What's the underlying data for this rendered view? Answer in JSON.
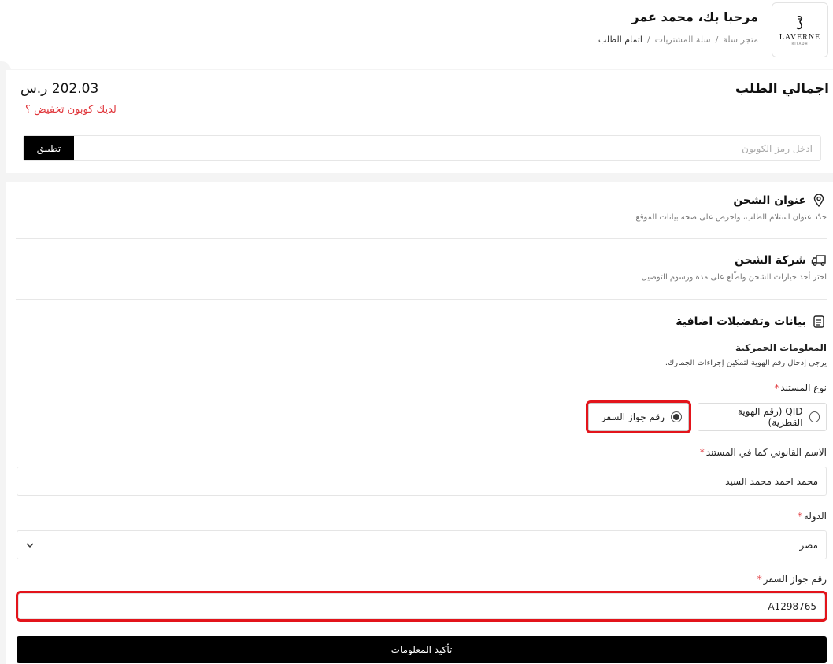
{
  "header": {
    "logo_text": "LAVERNE",
    "logo_sub": "RIYADH",
    "greeting": "مرحبا بك، محمد عمر",
    "breadcrumb": [
      "متجر سلة",
      "سلة المشتريات",
      "اتمام الطلب"
    ],
    "breadcrumb_sep": "/"
  },
  "summary": {
    "title": "اجمالي الطلب",
    "total": "202.03 ر.س",
    "coupon_link": "لديك كوبون تخفيض ؟",
    "coupon_placeholder": "ادخل رمز الكوبون",
    "apply_label": "تطبيق"
  },
  "shipping_address": {
    "title": "عنوان الشحن",
    "subtitle": "حدّد عنوان استلام الطلب، واحرص على صحة بيانات الموقع"
  },
  "shipping_company": {
    "title": "شركة الشحن",
    "subtitle": "اختر أحد خيارات الشحن واطّلع على مدة ورسوم التوصيل"
  },
  "extra": {
    "title": "بيانات وتفضيلات اضافية",
    "customs_title": "المعلومات الجمركية",
    "customs_sub": "يرجى إدخال رقم الهوية لتمكين إجراءات الجمارك.",
    "doc_type_label": "نوع المستند",
    "doc_options": [
      {
        "label": "رقم جواز السفر",
        "checked": true
      },
      {
        "label": "QID (رقم الهوية القطرية)",
        "checked": false
      }
    ],
    "legal_name_label": "الاسم القانوني كما في المستند",
    "legal_name_value": "محمد احمد محمد السيد",
    "country_label": "الدولة",
    "country_value": "مصر",
    "passport_label": "رقم جواز السفر",
    "passport_value": "A1298765",
    "required_mark": "*",
    "confirm_label": "تأكيد المعلومات"
  },
  "colors": {
    "accent_red": "#e0363b",
    "highlight_red": "#e3141b",
    "button_black": "#000000"
  }
}
